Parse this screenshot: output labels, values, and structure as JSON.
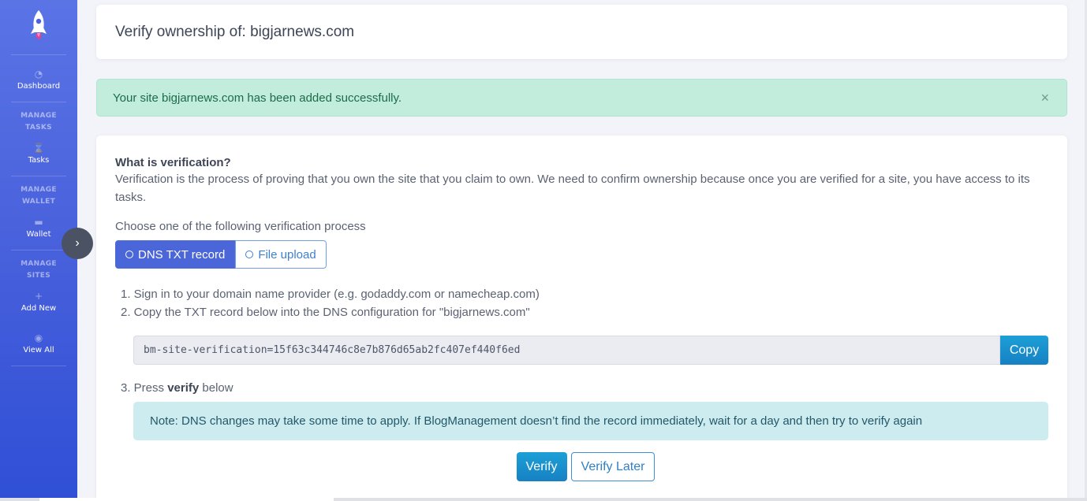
{
  "sidebar": {
    "dashboard": "Dashboard",
    "sections": [
      {
        "heading": "MANAGE TASKS",
        "item": "Tasks"
      },
      {
        "heading": "MANAGE WALLET",
        "item": "Wallet"
      },
      {
        "heading": "MANAGE SITES",
        "item": "Add New",
        "item2": "View All"
      }
    ]
  },
  "header": {
    "title": "Verify ownership of: bigjarnews.com"
  },
  "alert": {
    "message": "Your site bigjarnews.com has been added successfully.",
    "close": "×"
  },
  "verification": {
    "question": "What is verification?",
    "description": "Verification is the process of proving that you own the site that you claim to own. We need to confirm ownership because once you are verified for a site, you have access to its tasks.",
    "choose_label": "Choose one of the following verification process",
    "options": [
      "DNS TXT record",
      "File upload"
    ],
    "selected_option": "DNS TXT record",
    "step1": "1. Sign in to your domain name provider (e.g. godaddy.com or namecheap.com)",
    "step2": "2. Copy the TXT record below into the DNS configuration for \"bigjarnews.com\"",
    "txt_record": "bm-site-verification=15f63c344746c8e7b876d65ab2fc407ef440f6ed",
    "copy_label": "Copy",
    "step3_prefix": "3. Press ",
    "step3_bold": "verify",
    "step3_suffix": " below",
    "note": "Note: DNS changes may take some time to apply. If BlogManagement doesn’t find the record immediately, wait for a day and then try to verify again",
    "verify_label": "Verify",
    "verify_later_label": "Verify Later"
  },
  "colors": {
    "sidebar_top": "#5a74e6",
    "sidebar_bottom": "#2f4fd6",
    "primary": "#1681c4",
    "alert_bg": "#c2eddd",
    "note_bg": "#cdecf0"
  }
}
